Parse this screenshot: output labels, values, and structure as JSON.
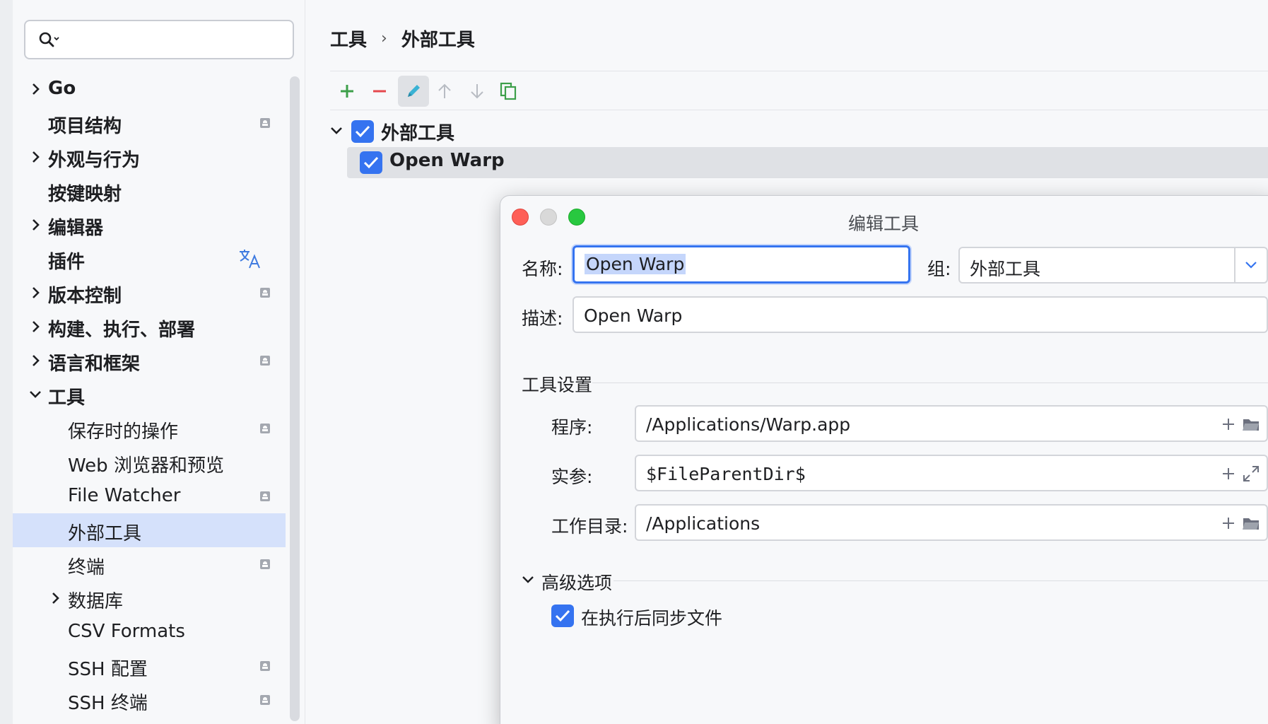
{
  "search": {
    "value": ""
  },
  "sidebar": {
    "items": [
      {
        "label": "Go",
        "level": 0,
        "chevron": "right",
        "badge": false
      },
      {
        "label": "项目结构",
        "level": 0,
        "chevron": "none",
        "badge": true
      },
      {
        "label": "外观与行为",
        "level": 0,
        "chevron": "right",
        "badge": false
      },
      {
        "label": "按键映射",
        "level": 0,
        "chevron": "none",
        "badge": false
      },
      {
        "label": "编辑器",
        "level": 0,
        "chevron": "right",
        "badge": false
      },
      {
        "label": "插件",
        "level": 0,
        "chevron": "none",
        "badge": false,
        "icon": "translate-icon"
      },
      {
        "label": "版本控制",
        "level": 0,
        "chevron": "right",
        "badge": true
      },
      {
        "label": "构建、执行、部署",
        "level": 0,
        "chevron": "right",
        "badge": false
      },
      {
        "label": "语言和框架",
        "level": 0,
        "chevron": "right",
        "badge": true
      },
      {
        "label": "工具",
        "level": 0,
        "chevron": "down",
        "badge": false
      },
      {
        "label": "保存时的操作",
        "level": 1,
        "chevron": "none",
        "badge": true
      },
      {
        "label": "Web 浏览器和预览",
        "level": 1,
        "chevron": "none",
        "badge": false
      },
      {
        "label": "File Watcher",
        "level": 1,
        "chevron": "none",
        "badge": true
      },
      {
        "label": "外部工具",
        "level": 1,
        "chevron": "none",
        "badge": false,
        "selected": true
      },
      {
        "label": "终端",
        "level": 1,
        "chevron": "none",
        "badge": true
      },
      {
        "label": "数据库",
        "level": 1,
        "chevron": "right",
        "badge": false
      },
      {
        "label": "CSV Formats",
        "level": 1,
        "chevron": "none",
        "badge": false
      },
      {
        "label": "SSH 配置",
        "level": 1,
        "chevron": "none",
        "badge": true
      },
      {
        "label": "SSH 终端",
        "level": 1,
        "chevron": "none",
        "badge": true
      }
    ]
  },
  "breadcrumb": {
    "parent": "工具",
    "separator": "›",
    "current": "外部工具"
  },
  "toolbar": {
    "buttons": [
      {
        "name": "add-icon",
        "color": "#3d9f4a"
      },
      {
        "name": "remove-icon",
        "color": "#e5484d"
      },
      {
        "name": "edit-icon",
        "color": "#3ab2d4",
        "active": true
      },
      {
        "name": "move-up-icon",
        "color": "#b8bcc3"
      },
      {
        "name": "move-down-icon",
        "color": "#b8bcc3"
      },
      {
        "name": "copy-icon",
        "color": "#3d9f4a"
      }
    ]
  },
  "tools_tree": {
    "group_label": "外部工具",
    "group_checked": true,
    "tool_label": "Open Warp",
    "tool_checked": true
  },
  "dialog": {
    "title": "编辑工具",
    "name_label": "名称:",
    "name_value": "Open Warp",
    "group_label": "组:",
    "group_value": "外部工具",
    "desc_label": "描述:",
    "desc_value": "Open Warp",
    "tool_settings_title": "工具设置",
    "program_label": "程序:",
    "program_value": "/Applications/Warp.app",
    "args_label": "实参:",
    "args_value": "$FileParentDir$",
    "workdir_label": "工作目录:",
    "workdir_value": "/Applications",
    "advanced_title": "高级选项",
    "sync_label": "在执行后同步文件",
    "sync_checked": true
  },
  "colors": {
    "accent": "#3574f0",
    "selection": "#d5e1fb",
    "close": "#fe5f57",
    "minimize": "#d9d9d9",
    "maximize": "#28c840"
  }
}
